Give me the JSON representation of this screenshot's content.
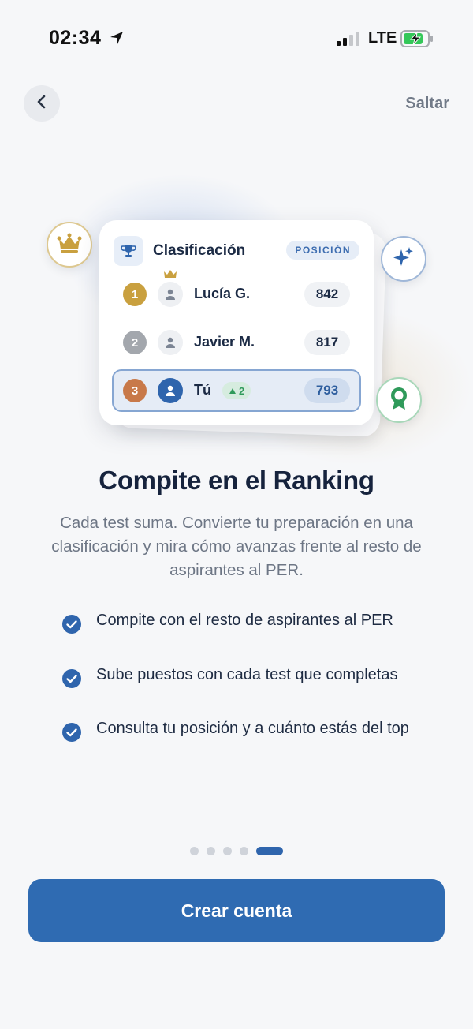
{
  "status_bar": {
    "time": "02:34",
    "network": "LTE"
  },
  "nav": {
    "skip_label": "Saltar"
  },
  "leaderboard": {
    "title": "Clasificación",
    "badge": "POSICIÓN",
    "rows": [
      {
        "rank": "1",
        "name": "Lucía G.",
        "score": "842",
        "rank_color": "#c9a03f"
      },
      {
        "rank": "2",
        "name": "Javier M.",
        "score": "817",
        "rank_color": "#a3a7ad"
      },
      {
        "rank": "3",
        "name": "Tú",
        "score": "793",
        "delta": "2",
        "rank_color": "#c87949"
      }
    ]
  },
  "headline": "Compite en el Ranking",
  "subtitle": "Cada test suma. Convierte tu preparación en una clasificación y mira cómo avanzas frente al resto de aspirantes al PER.",
  "features": [
    {
      "text": "Compite con el resto de aspirantes al PER"
    },
    {
      "text": "Sube puestos con cada test que completas"
    },
    {
      "text": "Consulta tu posición y a cuánto estás del top"
    }
  ],
  "pager": {
    "total": 5,
    "active": 5
  },
  "cta": {
    "label": "Crear cuenta"
  },
  "colors": {
    "primary": "#2f6bb2",
    "success": "#2f9a5a",
    "gold": "#c9a03f"
  }
}
